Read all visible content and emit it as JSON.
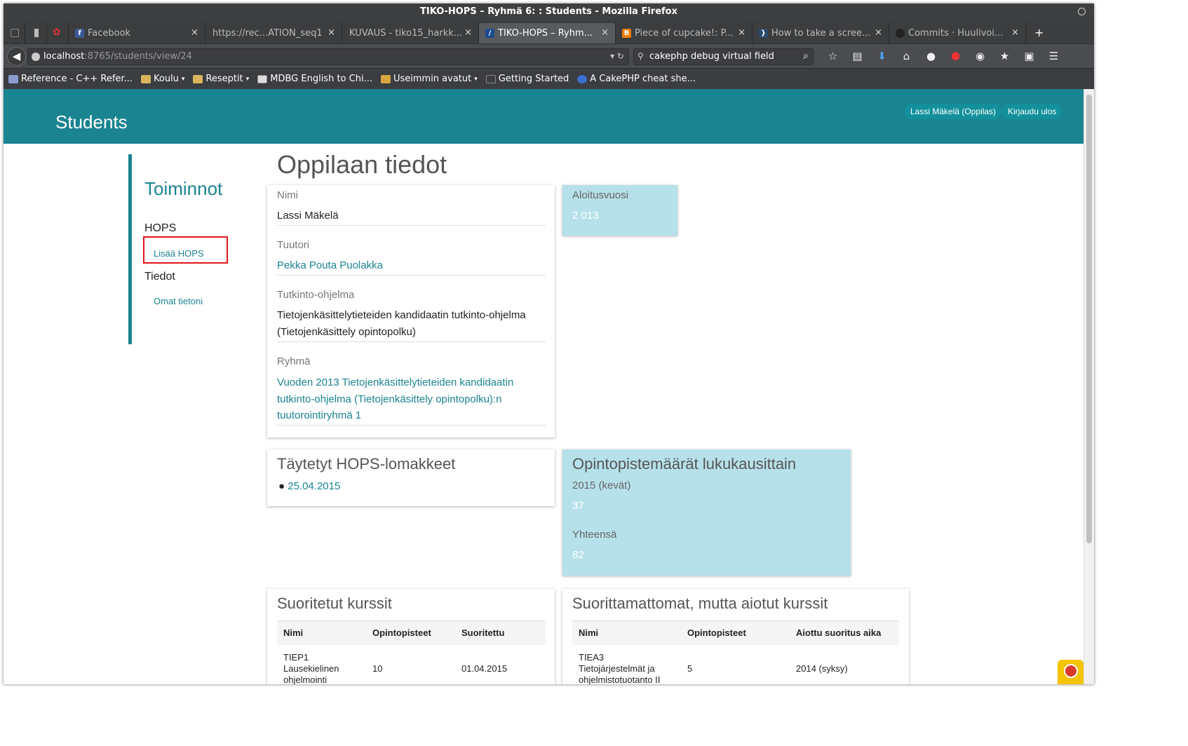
{
  "window": {
    "title": "TIKO-HOPS – Ryhmä 6: : Students - Mozilla Firefox"
  },
  "tabs": [
    {
      "label": "Facebook",
      "active": false
    },
    {
      "label": "https://rec...ATION_seq1",
      "active": false
    },
    {
      "label": "KUVAUS - tiko15_harkk...",
      "active": false
    },
    {
      "label": "TIKO-HOPS – Ryhm...",
      "active": true
    },
    {
      "label": "Piece of cupcake!: P...",
      "active": false
    },
    {
      "label": "How to take a scree...",
      "active": false
    },
    {
      "label": "Commits · Huulivoi...",
      "active": false
    }
  ],
  "newtab": "+",
  "navbar": {
    "url_host": "localhost",
    "url_rest": ":8765/students/view/24",
    "search_value": "cakephp debug virtual field"
  },
  "bookmarks": [
    {
      "label": "Reference - C++ Refer..."
    },
    {
      "label": "Koulu"
    },
    {
      "label": "Reseptit"
    },
    {
      "label": "MDBG English to Chi..."
    },
    {
      "label": "Useimmin avatut"
    },
    {
      "label": "Getting Started"
    },
    {
      "label": "A CakePHP cheat she..."
    }
  ],
  "header": {
    "brand": "Students",
    "user": "Lassi Mäkelä (Oppilas)",
    "logout": "Kirjaudu ulos"
  },
  "sidebar": {
    "title": "Toiminnot",
    "sections": [
      {
        "heading": "HOPS",
        "link": "Lisää HOPS"
      },
      {
        "heading": "Tiedot",
        "link": "Omat tietoni"
      }
    ]
  },
  "main": {
    "heading": "Oppilaan tiedot",
    "info": {
      "name_label": "Nimi",
      "name_value": "Lassi Mäkelä",
      "tutor_label": "Tuutori",
      "tutor_value": "Pekka Pouta Puolakka",
      "program_label": "Tutkinto-ohjelma",
      "program_line1": "Tietojenkäsittelytieteiden kandidaatin tutkinto-ohjelma",
      "program_line2": "(Tietojenkäsittely opintopolku)",
      "group_label": "Ryhmä",
      "group_line1": "Vuoden 2013 Tietojenkäsittelytieteiden kandidaatin",
      "group_line2": "tutkinto-ohjelma (Tietojenkäsittely opintopolku):n",
      "group_line3": "tuutorointiryhmä 1"
    },
    "start": {
      "label": "Aloitusvuosi",
      "value": "2 013"
    },
    "hops_forms": {
      "title": "Täytetyt HOPS-lomakkeet",
      "items": [
        "25.04.2015"
      ]
    },
    "credits": {
      "title": "Opintopistemäärät lukukausittain",
      "term_label": "2015 (kevät)",
      "term_value": "37",
      "total_label": "Yhteensä",
      "total_value": "82"
    },
    "completed": {
      "title": "Suoritetut kurssit",
      "headers": [
        "Nimi",
        "Opintopisteet",
        "Suoritettu"
      ],
      "rows": [
        {
          "name1": "TIEP1",
          "name2": "Lausekielinen",
          "name3": "ohjelmointi",
          "credits": "10",
          "date": "01.04.2015"
        }
      ]
    },
    "planned": {
      "title": "Suorittamattomat, mutta aiotut kurssit",
      "headers": [
        "Nimi",
        "Opintopisteet",
        "Aiottu suoritus aika"
      ],
      "rows": [
        {
          "name1": "TIEA3",
          "name2": "Tietojärjestelmät ja",
          "name3": "ohjelmistotuotanto II",
          "credits": "5",
          "when": "2014 (syksy)"
        }
      ]
    }
  },
  "colors": {
    "accent": "#1a8490",
    "card_blue": "#b6e1ea",
    "highlight": "#e0141c"
  }
}
